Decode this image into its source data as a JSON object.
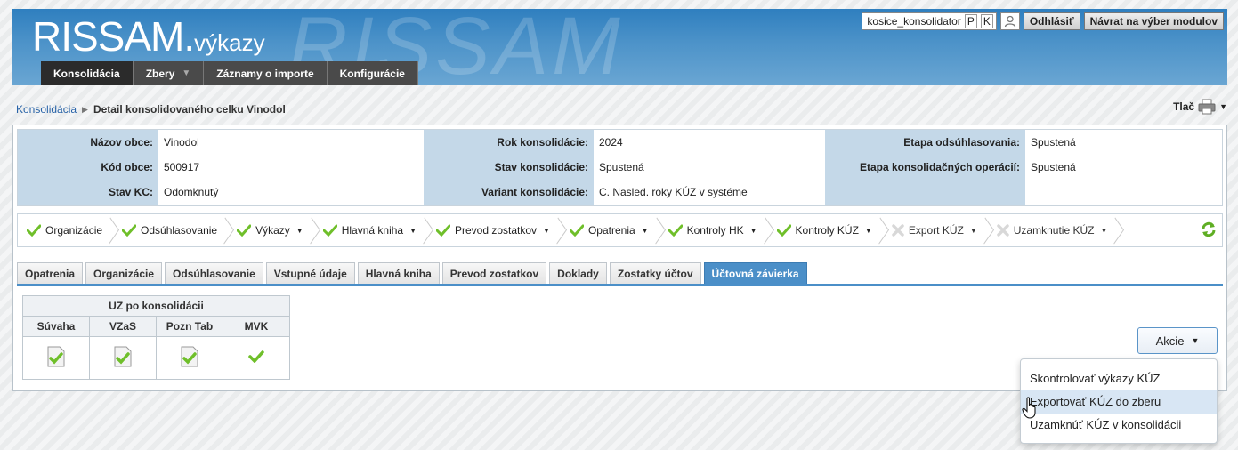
{
  "header": {
    "logo_main": "RISSAM.",
    "logo_sub": "výkazy",
    "watermark": "RISSAM",
    "username": "kosice_konsolidator",
    "initial_1": "P",
    "initial_2": "K",
    "logout": "Odhlásiť",
    "back_to_modules": "Návrat na výber modulov"
  },
  "nav": [
    {
      "label": "Konsolidácia"
    },
    {
      "label": "Zbery"
    },
    {
      "label": "Záznamy o importe"
    },
    {
      "label": "Konfigurácie"
    }
  ],
  "breadcrumb": {
    "root": "Konsolidácia",
    "current": "Detail konsolidovaného celku Vinodol"
  },
  "print_label": "Tlač",
  "info": {
    "col1": [
      {
        "label": "Názov obce:",
        "value": "Vinodol"
      },
      {
        "label": "Kód obce:",
        "value": "500917"
      },
      {
        "label": "Stav KC:",
        "value": "Odomknutý"
      }
    ],
    "col2": [
      {
        "label": "Rok konsolidácie:",
        "value": "2024"
      },
      {
        "label": "Stav konsolidácie:",
        "value": "Spustená"
      },
      {
        "label": "Variant konsolidácie:",
        "value": "C. Nasled. roky KÚZ v systéme"
      }
    ],
    "col3": [
      {
        "label": "Etapa odsúhlasovania:",
        "value": "Spustená"
      },
      {
        "label": "Etapa konsolidačných operácií:",
        "value": "Spustená"
      },
      {
        "label": "",
        "value": ""
      }
    ]
  },
  "workflow": [
    {
      "label": "Organizácie"
    },
    {
      "label": "Odsúhlasovanie"
    },
    {
      "label": "Výkazy"
    },
    {
      "label": "Hlavná kniha"
    },
    {
      "label": "Prevod zostatkov"
    },
    {
      "label": "Opatrenia"
    },
    {
      "label": "Kontroly HK"
    },
    {
      "label": "Kontroly KÚZ"
    },
    {
      "label": "Export KÚZ"
    },
    {
      "label": "Uzamknutie KÚZ"
    }
  ],
  "tabs": [
    {
      "label": "Opatrenia"
    },
    {
      "label": "Organizácie"
    },
    {
      "label": "Odsúhlasovanie"
    },
    {
      "label": "Vstupné údaje"
    },
    {
      "label": "Hlavná kniha"
    },
    {
      "label": "Prevod zostatkov"
    },
    {
      "label": "Doklady"
    },
    {
      "label": "Zostatky účtov"
    },
    {
      "label": "Účtovná závierka"
    }
  ],
  "uz_table": {
    "group_header": "UZ po konsolidácii",
    "columns": [
      "Súvaha",
      "VZaS",
      "Pozn Tab",
      "MVK"
    ]
  },
  "actions": {
    "button": "Akcie",
    "menu": [
      {
        "label": "Skontrolovať výkazy KÚZ"
      },
      {
        "label": "Exportovať KÚZ do zberu"
      },
      {
        "label": "Uzamknúť KÚZ v konsolidácii"
      }
    ]
  },
  "colors": {
    "header_blue": "#3f89c5",
    "tab_active": "#4b8fc8",
    "check_green": "#6fbf2a"
  }
}
